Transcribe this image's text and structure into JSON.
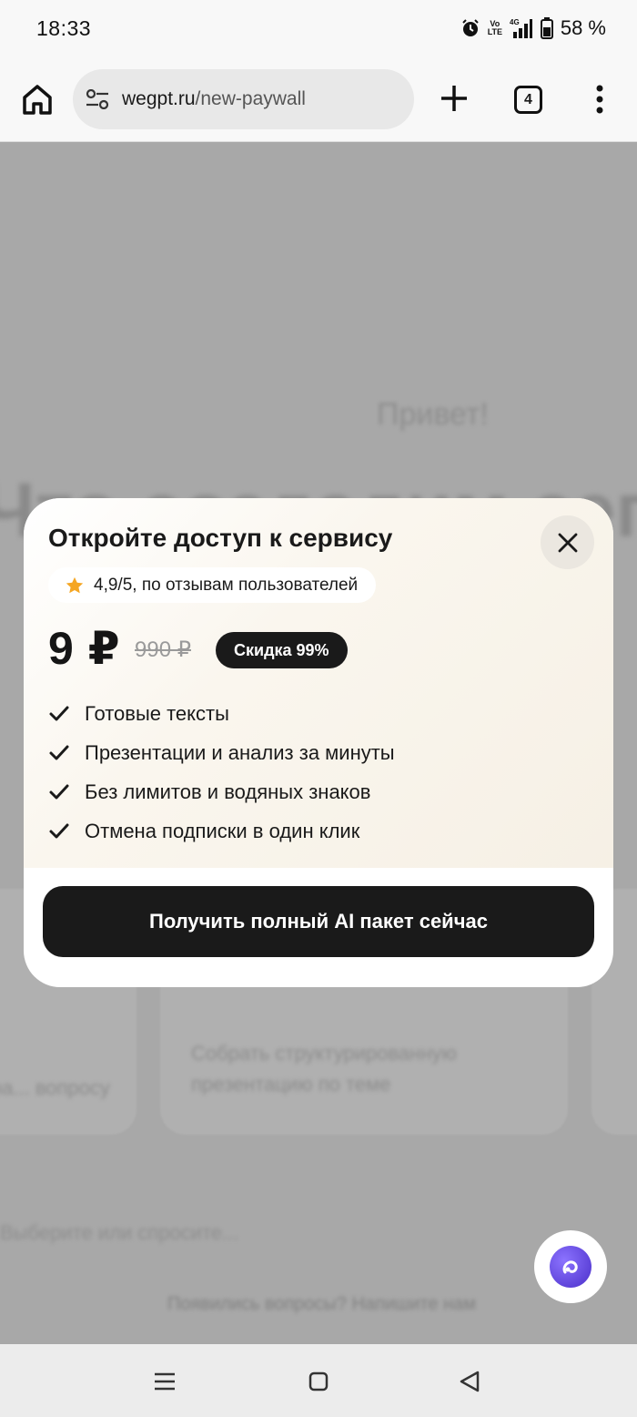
{
  "status_bar": {
    "time": "18:33",
    "battery": "58 %",
    "network": "4G",
    "volte": "Vo LTE"
  },
  "browser": {
    "url_domain": "wegpt.ru",
    "url_path": "/new-paywall",
    "tab_count": "4"
  },
  "background_page": {
    "greeting": "Привет!",
    "headline": "Что создадим сегодня?",
    "card_text": "Собрать структурированную презентацию по теме",
    "card_text_left": "на... вопросу",
    "input_placeholder": "Выберите или спросите...",
    "footer_text": "Появились вопросы? Напишите нам"
  },
  "paywall": {
    "title": "Откройте доступ к сервису",
    "rating": "4,9/5, по отзывам пользователей",
    "price": "9 ₽",
    "old_price": "990 ₽",
    "discount": "Скидка 99%",
    "features": [
      "Готовые тексты",
      "Презентации и анализ за минуты",
      "Без лимитов и водяных знаков",
      "Отмена подписки в один клик"
    ],
    "cta": "Получить полный AI пакет сейчас"
  },
  "colors": {
    "accent_dark": "#1a1a1a",
    "star": "#f5a623",
    "chat_fab": "#5a3fd6"
  }
}
